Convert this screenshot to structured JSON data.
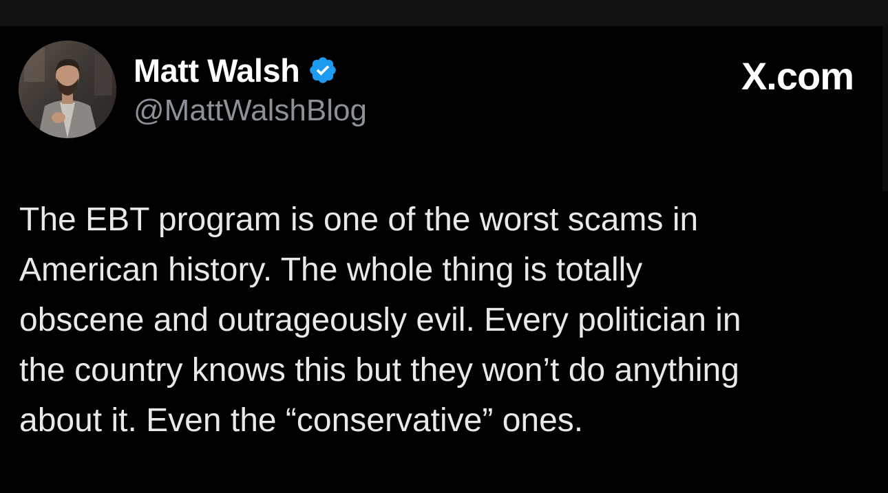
{
  "author": {
    "name": "Matt Walsh",
    "handle": "@MattWalshBlog",
    "verified": true,
    "avatar_icon": "profile-photo"
  },
  "site_mark": "X.com",
  "tweet": {
    "lines": [
      "The EBT program is one of the worst scams in",
      "American history. The whole thing is totally",
      "obscene and outrageously evil. Every politician in",
      "the country knows this but they won’t do anything",
      "about it. Even the “conservative” ones."
    ]
  },
  "colors": {
    "background": "#000000",
    "text": "#e7e9ea",
    "handle": "#8b9197",
    "verified_badge": "#1d9bf0"
  }
}
